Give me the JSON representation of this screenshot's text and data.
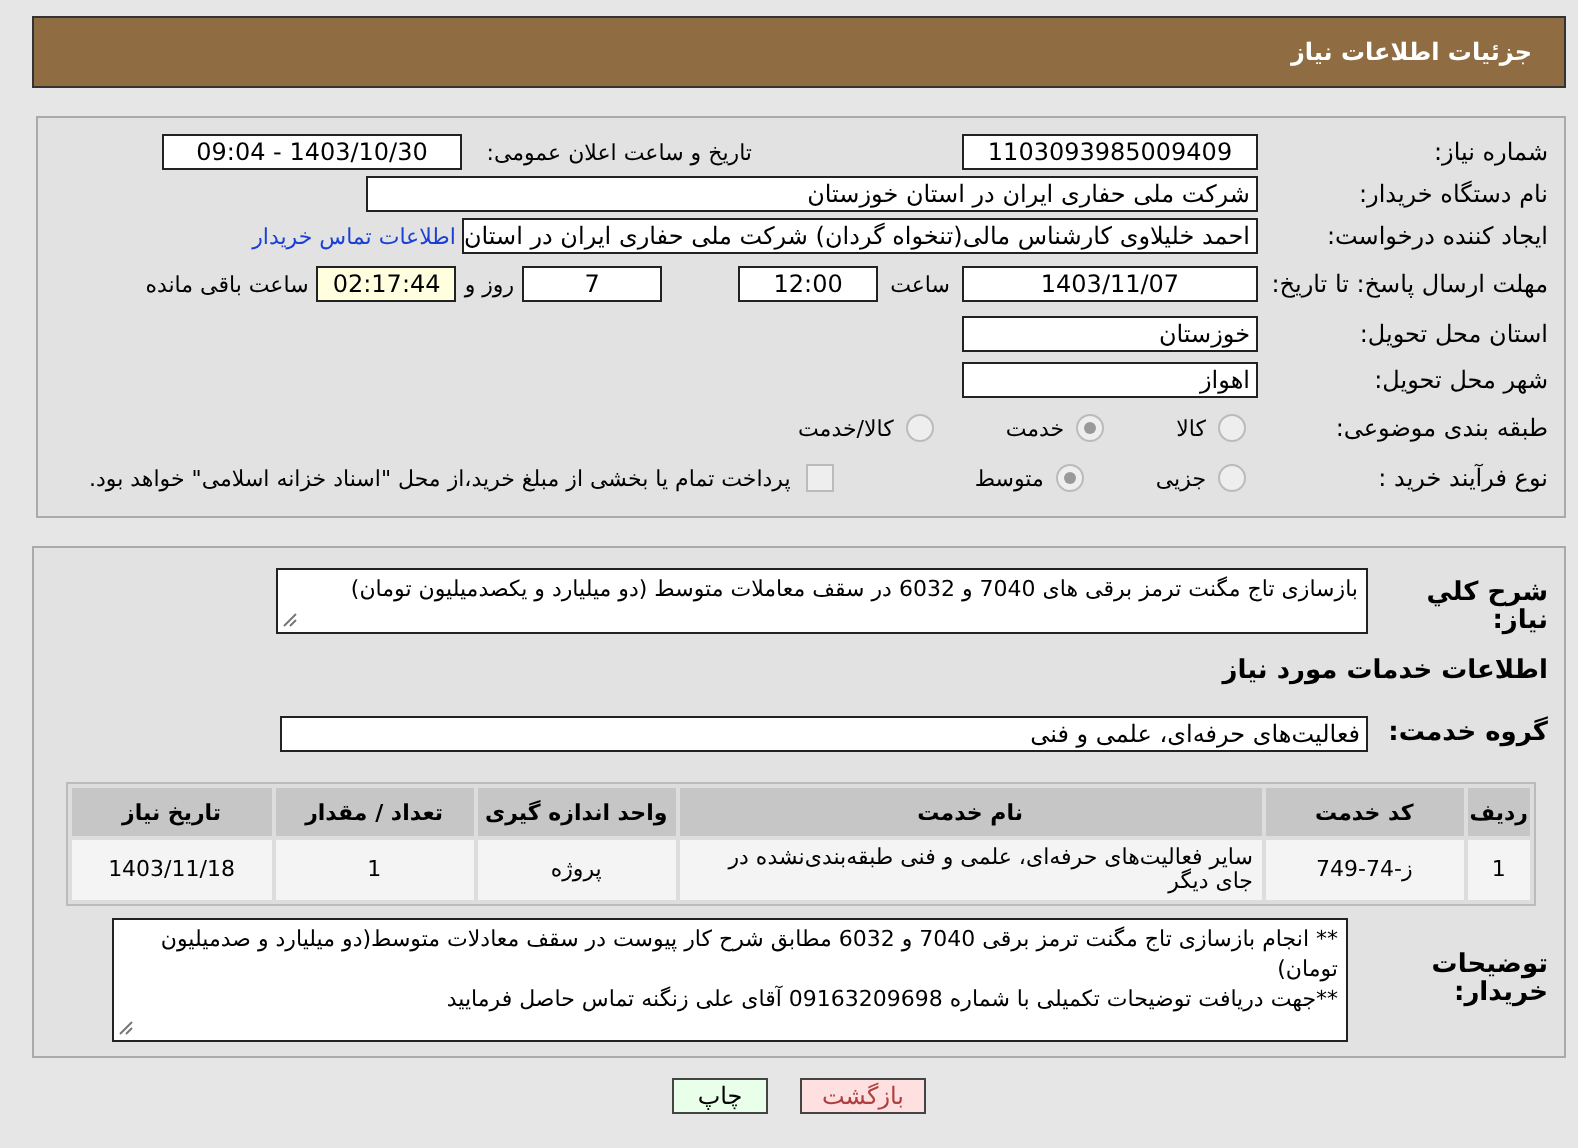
{
  "header": {
    "title": "جزئیات اطلاعات نیاز"
  },
  "need_number": {
    "label": "شماره نیاز:",
    "value": "1103093985009409"
  },
  "announce_date": {
    "label": "تاریخ و ساعت اعلان عمومی:",
    "value": "1403/10/30 - 09:04"
  },
  "buyer_org": {
    "label": "نام دستگاه خریدار:",
    "value": "شرکت ملی حفاری ایران در استان خوزستان"
  },
  "requester": {
    "label": "ایجاد کننده درخواست:",
    "value": "احمد خلیلاوی کارشناس مالی(تنخواه گردان) شرکت ملی حفاری ایران در استان",
    "link": "اطلاعات تماس خریدار"
  },
  "deadline": {
    "label": "مهلت ارسال پاسخ: تا تاریخ:",
    "date": "1403/11/07",
    "time_label": "ساعت",
    "time": "12:00",
    "days": "7",
    "days_label": "روز و",
    "remaining": "02:17:44",
    "remaining_label": "ساعت باقی مانده"
  },
  "province": {
    "label": "استان محل تحویل:",
    "value": "خوزستان"
  },
  "city": {
    "label": "شهر محل تحویل:",
    "value": "اهواز"
  },
  "category": {
    "label": "طبقه بندی موضوعی:",
    "options": [
      {
        "label": "کالا",
        "selected": false
      },
      {
        "label": "خدمت",
        "selected": true
      },
      {
        "label": "کالا/خدمت",
        "selected": false
      }
    ]
  },
  "purchase_type": {
    "label": "نوع فرآیند خرید :",
    "options": [
      {
        "label": "جزیی",
        "selected": false
      },
      {
        "label": "متوسط",
        "selected": true
      }
    ],
    "payment": {
      "label": "پرداخت تمام یا بخشی از مبلغ خرید،از محل \"اسناد خزانه اسلامی\" خواهد بود.",
      "checked": false
    }
  },
  "description": {
    "label": "شرح کلي نیاز:",
    "value": "بازسازی تاج مگنت ترمز برقی های 7040 و 6032 در سقف معاملات متوسط (دو میلیارد و یکصدمیلیون تومان)"
  },
  "services_heading": "اطلاعات خدمات مورد نیاز",
  "service_group": {
    "label": "گروه خدمت:",
    "value": "فعالیت‌های حرفه‌ای، علمی و فنی"
  },
  "table": {
    "columns": [
      "ردیف",
      "کد خدمت",
      "نام خدمت",
      "واحد اندازه گیری",
      "تعداد / مقدار",
      "تاریخ نیاز"
    ],
    "rows": [
      [
        "1",
        "ز-74-749",
        "سایر فعالیت‌های حرفه‌ای، علمی و فنی طبقه‌بندی‌نشده در جای دیگر",
        "پروژه",
        "1",
        "1403/11/18"
      ]
    ]
  },
  "buyer_notes": {
    "label": "توضیحات خریدار:",
    "value": "** انجام بازسازی تاج مگنت ترمز برقی 7040 و 6032 مطابق شرح کار پیوست در سقف معادلات متوسط(دو میلیارد و صدمیلیون تومان)\n**جهت دریافت توضیحات تکمیلی با شماره 09163209698 آقای علی زنگنه تماس حاصل فرمایید"
  },
  "buttons": [
    {
      "label": "بازگشت",
      "kind": "back"
    },
    {
      "label": "چاپ",
      "kind": "print"
    }
  ]
}
